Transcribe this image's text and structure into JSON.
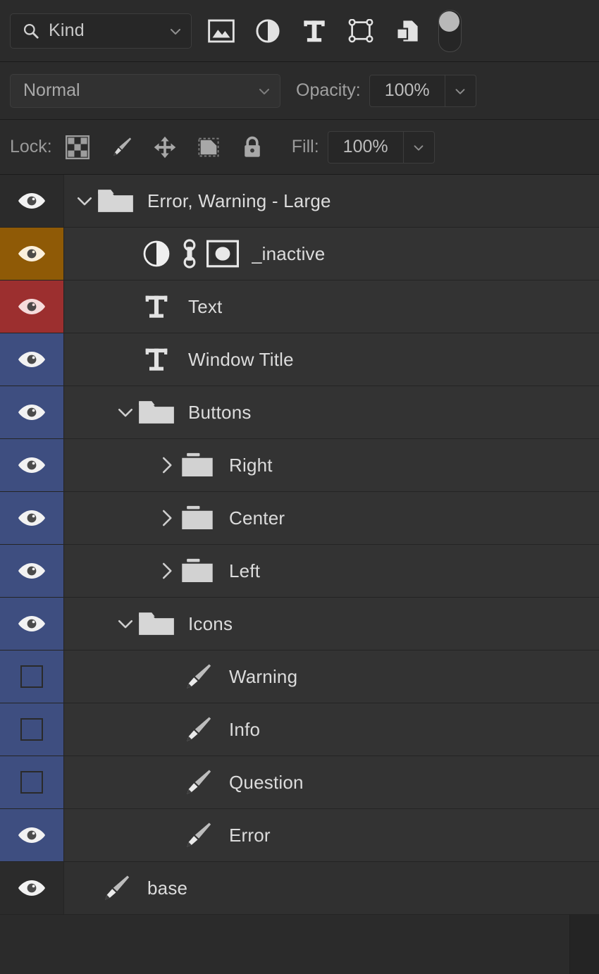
{
  "panel": {
    "name": "Layers",
    "colors": {
      "bg": "#2b2b2b",
      "row_bg": "#303030",
      "swatch_orange": "#8f5a06",
      "swatch_red": "#9c2f2f",
      "swatch_blue": "#3e4e80",
      "text": "#dcdcdc"
    }
  },
  "filter": {
    "search_icon": "search-icon",
    "kind_value": "Kind",
    "kind_placeholder": "Kind",
    "dropdown_icon": "chevron-down-icon",
    "type_filters": [
      {
        "name": "filter-pixel-layers",
        "icon": "image-icon"
      },
      {
        "name": "filter-adjustment-layers",
        "icon": "adjustment-circle-icon"
      },
      {
        "name": "filter-type-layers",
        "icon": "type-t-icon"
      },
      {
        "name": "filter-shape-layers",
        "icon": "shape-bounds-icon"
      },
      {
        "name": "filter-smart-objects",
        "icon": "smart-object-icon"
      }
    ],
    "toggle": {
      "name": "filter-enable-toggle",
      "state": "on"
    }
  },
  "blend": {
    "mode": "Normal",
    "mode_dropdown_icon": "chevron-down-icon",
    "opacity_label": "Opacity:",
    "opacity_value": "100%",
    "opacity_stepper_icon": "chevron-down-icon"
  },
  "lock": {
    "label": "Lock:",
    "items": [
      {
        "name": "lock-transparent-pixels",
        "icon": "checkerboard-icon"
      },
      {
        "name": "lock-image-pixels",
        "icon": "brush-icon"
      },
      {
        "name": "lock-position",
        "icon": "move-arrows-icon"
      },
      {
        "name": "lock-artboard-nesting",
        "icon": "artboard-icon"
      },
      {
        "name": "lock-all",
        "icon": "lock-icon"
      }
    ],
    "fill_label": "Fill:",
    "fill_value": "100%",
    "fill_stepper_icon": "chevron-down-icon"
  },
  "layers": [
    {
      "name": "Error, Warning - Large",
      "type": "group",
      "visible": true,
      "swatch": "none",
      "indent": 0,
      "disclosure": "expanded",
      "thumb_icon": "folder-open-icon",
      "extra_icons": []
    },
    {
      "name": "_inactive",
      "type": "adjustment",
      "visible": true,
      "swatch": "orange",
      "indent": 1,
      "disclosure": "none",
      "thumb_icon": "adjustment-circle-icon",
      "extra_icons": [
        "link-icon",
        "layer-mask-icon"
      ]
    },
    {
      "name": "Text",
      "type": "type",
      "visible": true,
      "swatch": "red",
      "indent": 1,
      "disclosure": "none",
      "thumb_icon": "type-t-icon",
      "extra_icons": []
    },
    {
      "name": "Window Title",
      "type": "type",
      "visible": true,
      "swatch": "blue",
      "indent": 1,
      "disclosure": "none",
      "thumb_icon": "type-t-icon",
      "extra_icons": []
    },
    {
      "name": "Buttons",
      "type": "group",
      "visible": true,
      "swatch": "blue",
      "indent": 1,
      "disclosure": "expanded",
      "thumb_icon": "folder-open-icon",
      "extra_icons": []
    },
    {
      "name": "Right",
      "type": "group",
      "visible": true,
      "swatch": "blue",
      "indent": 2,
      "disclosure": "collapsed",
      "thumb_icon": "folder-closed-icon",
      "extra_icons": []
    },
    {
      "name": "Center",
      "type": "group",
      "visible": true,
      "swatch": "blue",
      "indent": 2,
      "disclosure": "collapsed",
      "thumb_icon": "folder-closed-icon",
      "extra_icons": []
    },
    {
      "name": "Left",
      "type": "group",
      "visible": true,
      "swatch": "blue",
      "indent": 2,
      "disclosure": "collapsed",
      "thumb_icon": "folder-closed-icon",
      "extra_icons": []
    },
    {
      "name": "Icons",
      "type": "group",
      "visible": true,
      "swatch": "blue",
      "indent": 1,
      "disclosure": "expanded",
      "thumb_icon": "folder-open-icon",
      "extra_icons": []
    },
    {
      "name": "Warning",
      "type": "pixel",
      "visible": false,
      "swatch": "blue",
      "indent": 2,
      "disclosure": "none",
      "thumb_icon": "brush-icon",
      "extra_icons": []
    },
    {
      "name": "Info",
      "type": "pixel",
      "visible": false,
      "swatch": "blue",
      "indent": 2,
      "disclosure": "none",
      "thumb_icon": "brush-icon",
      "extra_icons": []
    },
    {
      "name": "Question",
      "type": "pixel",
      "visible": false,
      "swatch": "blue",
      "indent": 2,
      "disclosure": "none",
      "thumb_icon": "brush-icon",
      "extra_icons": []
    },
    {
      "name": "Error",
      "type": "pixel",
      "visible": true,
      "swatch": "blue",
      "indent": 2,
      "disclosure": "none",
      "thumb_icon": "brush-icon",
      "extra_icons": []
    },
    {
      "name": "base",
      "type": "pixel",
      "visible": true,
      "swatch": "none",
      "indent": 0,
      "disclosure": "none",
      "thumb_icon": "brush-icon",
      "extra_icons": []
    }
  ]
}
